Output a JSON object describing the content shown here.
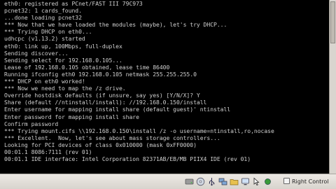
{
  "console": {
    "lines": [
      "eth0: registered as PCnet/FAST III 79C973",
      "pcnet32: 1 cards_found.",
      "...done loading pcnet32",
      "*** Now that we have loaded the modules (maybe), let's try DHCP...",
      "*** Trying DHCP on eth0...",
      "udhcpc (v1.13.2) started",
      "eth0: link up, 100Mbps, full-duplex",
      "Sending discover...",
      "Sending select for 192.168.0.105...",
      "Lease of 192.168.0.105 obtained, lease time 86400",
      "Running ifconfig eth0 192.168.0.105 netmask 255.255.255.0",
      "*** DHCP on eth0 worked!",
      "*** Now we need to map the /z drive.",
      "Override hostdisk defaults (if unsure, say yes) [Y/N/X]? Y",
      "Share (default //ntinstall/install): //192.168.0.150/install",
      "Enter username for mapping install share (default guest)' ntinstall",
      "Enter password for mapping install share",
      "Confirm password",
      "*** Trying mount.cifs \\\\192.168.0.150\\install /z -o username=ntinstall,ro,nocase",
      "*** Excellent.  Now, let's see about mass storage controllers...",
      "Looking for PCI devices of class 0x010000 (mask 0xFF0000)",
      "00:01.1 8086:7111 (rev 01)",
      "00:01.1 IDE interface: Intel Corporation 82371AB/EB/MB PIIX4 IDE (rev 01)"
    ]
  },
  "statusbar": {
    "icons": [
      "hard-disk-icon",
      "optical-drive-icon",
      "usb-icon",
      "network-icon",
      "shared-folder-icon",
      "capture-icon",
      "mouse-integration-icon",
      "status-led-icon"
    ],
    "host_key_label": "Right Control"
  }
}
